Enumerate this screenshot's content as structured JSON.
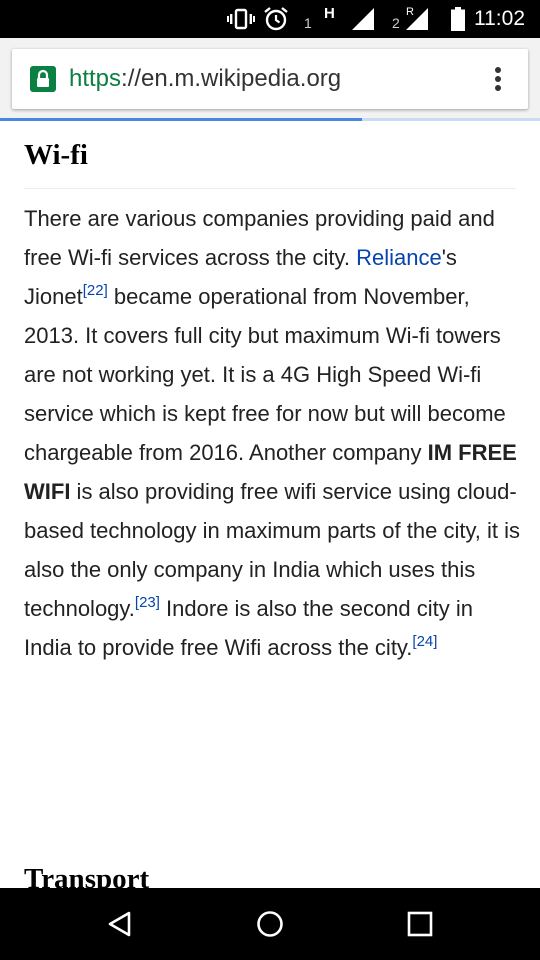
{
  "status_bar": {
    "sim1_label": "1",
    "network1_type": "H",
    "sim2_label": "2",
    "roaming_label": "R",
    "time": "11:02",
    "icons": [
      "vibrate-icon",
      "alarm-icon",
      "signal-icon",
      "signal-roaming-icon",
      "battery-icon"
    ]
  },
  "browser": {
    "url_scheme": "https",
    "url_rest": "://en.m.wikipedia.org",
    "lock_icon": "lock-icon",
    "menu_icon": "more-vert-icon",
    "load_progress": 0.67,
    "colors": {
      "secure": "#0b8043",
      "progress": "#4a86e0"
    }
  },
  "article": {
    "section_title": "Wi-fi",
    "paragraph": {
      "t1": "There are various companies providing paid and free Wi-fi services across the city. ",
      "link_reliance": "Reliance",
      "t2": "'s Jionet",
      "ref22": "[22]",
      "t3": " became operational from November, 2013. It covers full city but maximum Wi-fi towers are not working yet. It is a 4G High Speed Wi-fi service which is kept free for now but will become chargeable from 2016. Another company ",
      "bold_company": "IM FREE WIFI",
      "t4": " is also providing free wifi service using cloud-based technology in maximum parts of the city, it is also the only company in India which uses this technology.",
      "ref23": "[23]",
      "t5": " Indore is also the second city in India to provide free Wifi across the city.",
      "ref24": "[24]"
    },
    "next_section_title": "Transport",
    "link_color": "#0645ad"
  },
  "nav_bar": {
    "back_icon": "back-icon",
    "home_icon": "home-icon",
    "recents_icon": "recents-icon"
  }
}
